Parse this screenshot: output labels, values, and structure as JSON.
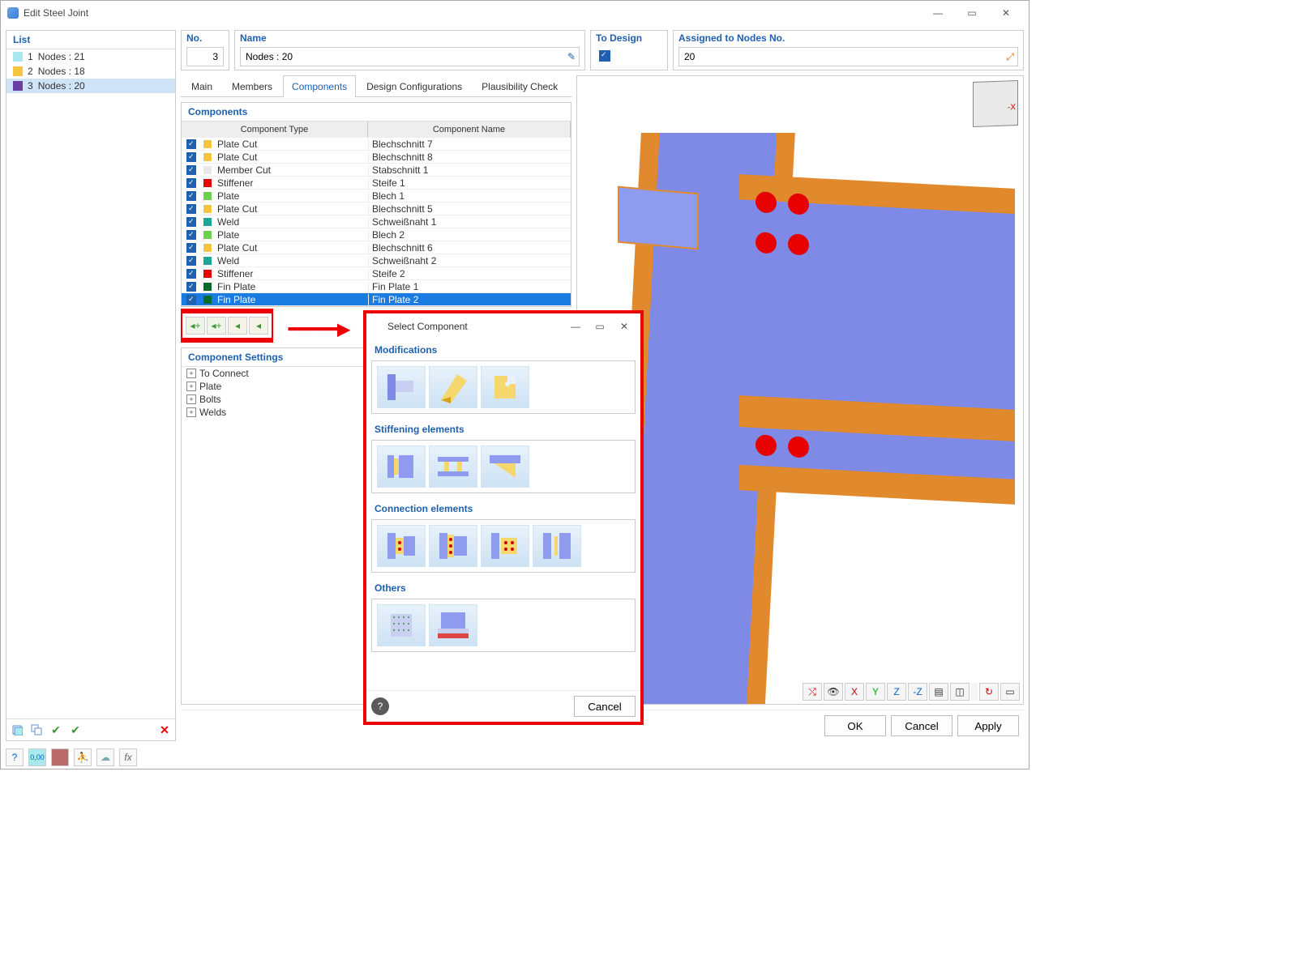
{
  "window": {
    "title": "Edit Steel Joint"
  },
  "left": {
    "header": "List",
    "items": [
      {
        "idx": "1",
        "label": "Nodes : 21",
        "color": "#a9e8ef"
      },
      {
        "idx": "2",
        "label": "Nodes : 18",
        "color": "#f5c542"
      },
      {
        "idx": "3",
        "label": "Nodes : 20",
        "color": "#6b3fa0",
        "selected": true
      }
    ]
  },
  "header": {
    "no_label": "No.",
    "no_value": "3",
    "name_label": "Name",
    "name_value": "Nodes : 20",
    "todesign_label": "To Design",
    "assigned_label": "Assigned to Nodes No.",
    "assigned_value": "20"
  },
  "tabs": [
    "Main",
    "Members",
    "Components",
    "Design Configurations",
    "Plausibility Check"
  ],
  "active_tab": "Components",
  "components": {
    "header": "Components",
    "col_type": "Component Type",
    "col_name": "Component Name",
    "rows": [
      {
        "type": "Plate Cut",
        "name": "Blechschnitt 7",
        "color": "#f5c542"
      },
      {
        "type": "Plate Cut",
        "name": "Blechschnitt 8",
        "color": "#f5c542"
      },
      {
        "type": "Member Cut",
        "name": "Stabschnitt 1",
        "color": "#e8e8e8"
      },
      {
        "type": "Stiffener",
        "name": "Steife 1",
        "color": "#e60000"
      },
      {
        "type": "Plate",
        "name": "Blech 1",
        "color": "#6ad24a"
      },
      {
        "type": "Plate Cut",
        "name": "Blechschnitt 5",
        "color": "#f5c542"
      },
      {
        "type": "Weld",
        "name": "Schweißnaht 1",
        "color": "#1aa79a"
      },
      {
        "type": "Plate",
        "name": "Blech 2",
        "color": "#6ad24a"
      },
      {
        "type": "Plate Cut",
        "name": "Blechschnitt 6",
        "color": "#f5c542"
      },
      {
        "type": "Weld",
        "name": "Schweißnaht 2",
        "color": "#1aa79a"
      },
      {
        "type": "Stiffener",
        "name": "Steife 2",
        "color": "#e60000"
      },
      {
        "type": "Fin Plate",
        "name": "Fin Plate 1",
        "color": "#0a6b2a"
      },
      {
        "type": "Fin Plate",
        "name": "Fin Plate 2",
        "color": "#0a6b2a",
        "selected": true
      }
    ]
  },
  "settings": {
    "header": "Component Settings",
    "items": [
      "To Connect",
      "Plate",
      "Bolts",
      "Welds"
    ]
  },
  "modal": {
    "title": "Select Component",
    "groups": {
      "mod": "Modifications",
      "stiff": "Stiffening elements",
      "conn": "Connection elements",
      "oth": "Others"
    },
    "cancel": "Cancel"
  },
  "footer": {
    "ok": "OK",
    "cancel": "Cancel",
    "apply": "Apply"
  }
}
